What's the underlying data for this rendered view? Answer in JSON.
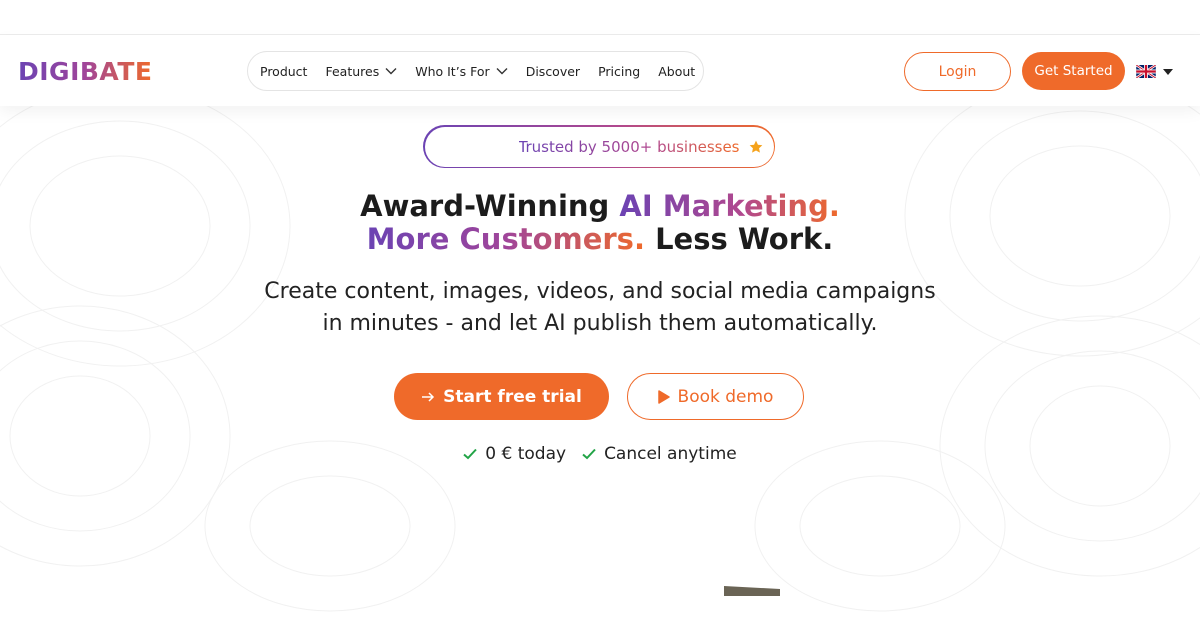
{
  "brand": {
    "name": "DIGIBATE",
    "accent": "#ef6a2a",
    "purple": "#6b43b3"
  },
  "nav": {
    "items": [
      {
        "label": "Product",
        "has_dropdown": false
      },
      {
        "label": "Features",
        "has_dropdown": true
      },
      {
        "label": "Who It’s For",
        "has_dropdown": true
      },
      {
        "label": "Discover",
        "has_dropdown": false
      },
      {
        "label": "Pricing",
        "has_dropdown": false
      },
      {
        "label": "About",
        "has_dropdown": false
      }
    ]
  },
  "header": {
    "login_label": "Login",
    "get_started_label": "Get Started",
    "language_icon": "uk-flag-icon"
  },
  "hero": {
    "trusted_badge": "Trusted by 5000+ businesses",
    "headline": {
      "line1_plain": "Award-Winning ",
      "line1_accent": "AI Marketing.",
      "line2_accent": "More Customers.",
      "line2_plain": " Less Work."
    },
    "subhead_line1": "Create content, images, videos, and social media campaigns",
    "subhead_line2": "in minutes - and let AI publish them automatically.",
    "cta_primary": "Start free trial",
    "cta_secondary": "Book demo",
    "checks": [
      "0 € today",
      "Cancel anytime"
    ]
  },
  "icons": {
    "star": "star-icon",
    "arrow": "arrow-right-icon",
    "play": "play-icon",
    "check": "check-icon",
    "chevron": "chevron-down-icon"
  }
}
